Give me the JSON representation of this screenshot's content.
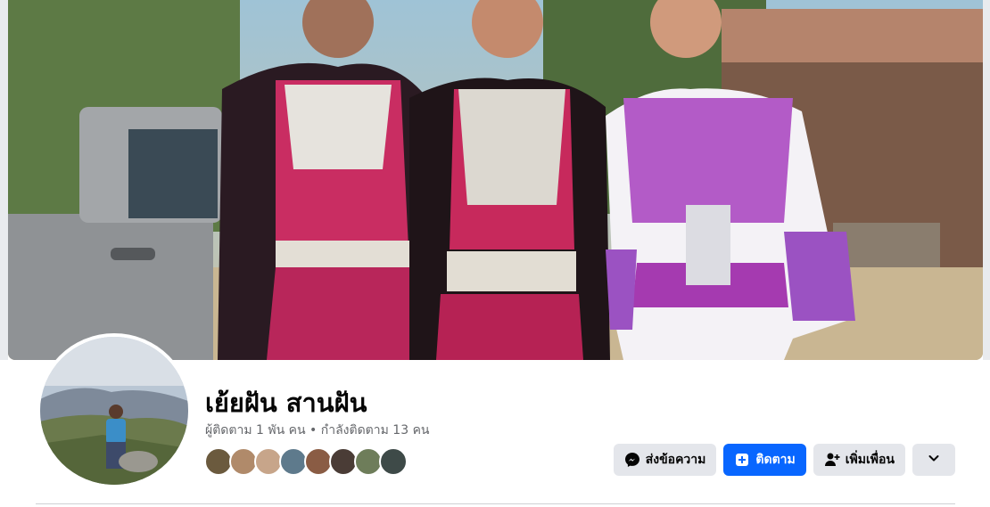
{
  "profile": {
    "name": "เย้ยฝัน สานฝัน",
    "followers_text": "ผู้ติดตาม 1 พัน คน",
    "separator": "•",
    "following_text": "กำลังติดตาม 13 คน"
  },
  "friends": {
    "count_shown": 8,
    "colors": [
      "#6b5a3e",
      "#b08a6a",
      "#c7a58a",
      "#5e7a8c",
      "#8a5c44",
      "#4a3c36",
      "#6e7d5a",
      "#3e4a48"
    ]
  },
  "actions": {
    "message_label": "ส่งข้อความ",
    "follow_label": "ติดตาม",
    "add_friend_label": "เพิ่มเพื่อน",
    "more_icon": "chevron-down-icon"
  },
  "colors": {
    "primary": "#0866ff",
    "secondary_button": "#e4e6eb",
    "text_primary": "#050505",
    "text_secondary": "#65676b"
  }
}
